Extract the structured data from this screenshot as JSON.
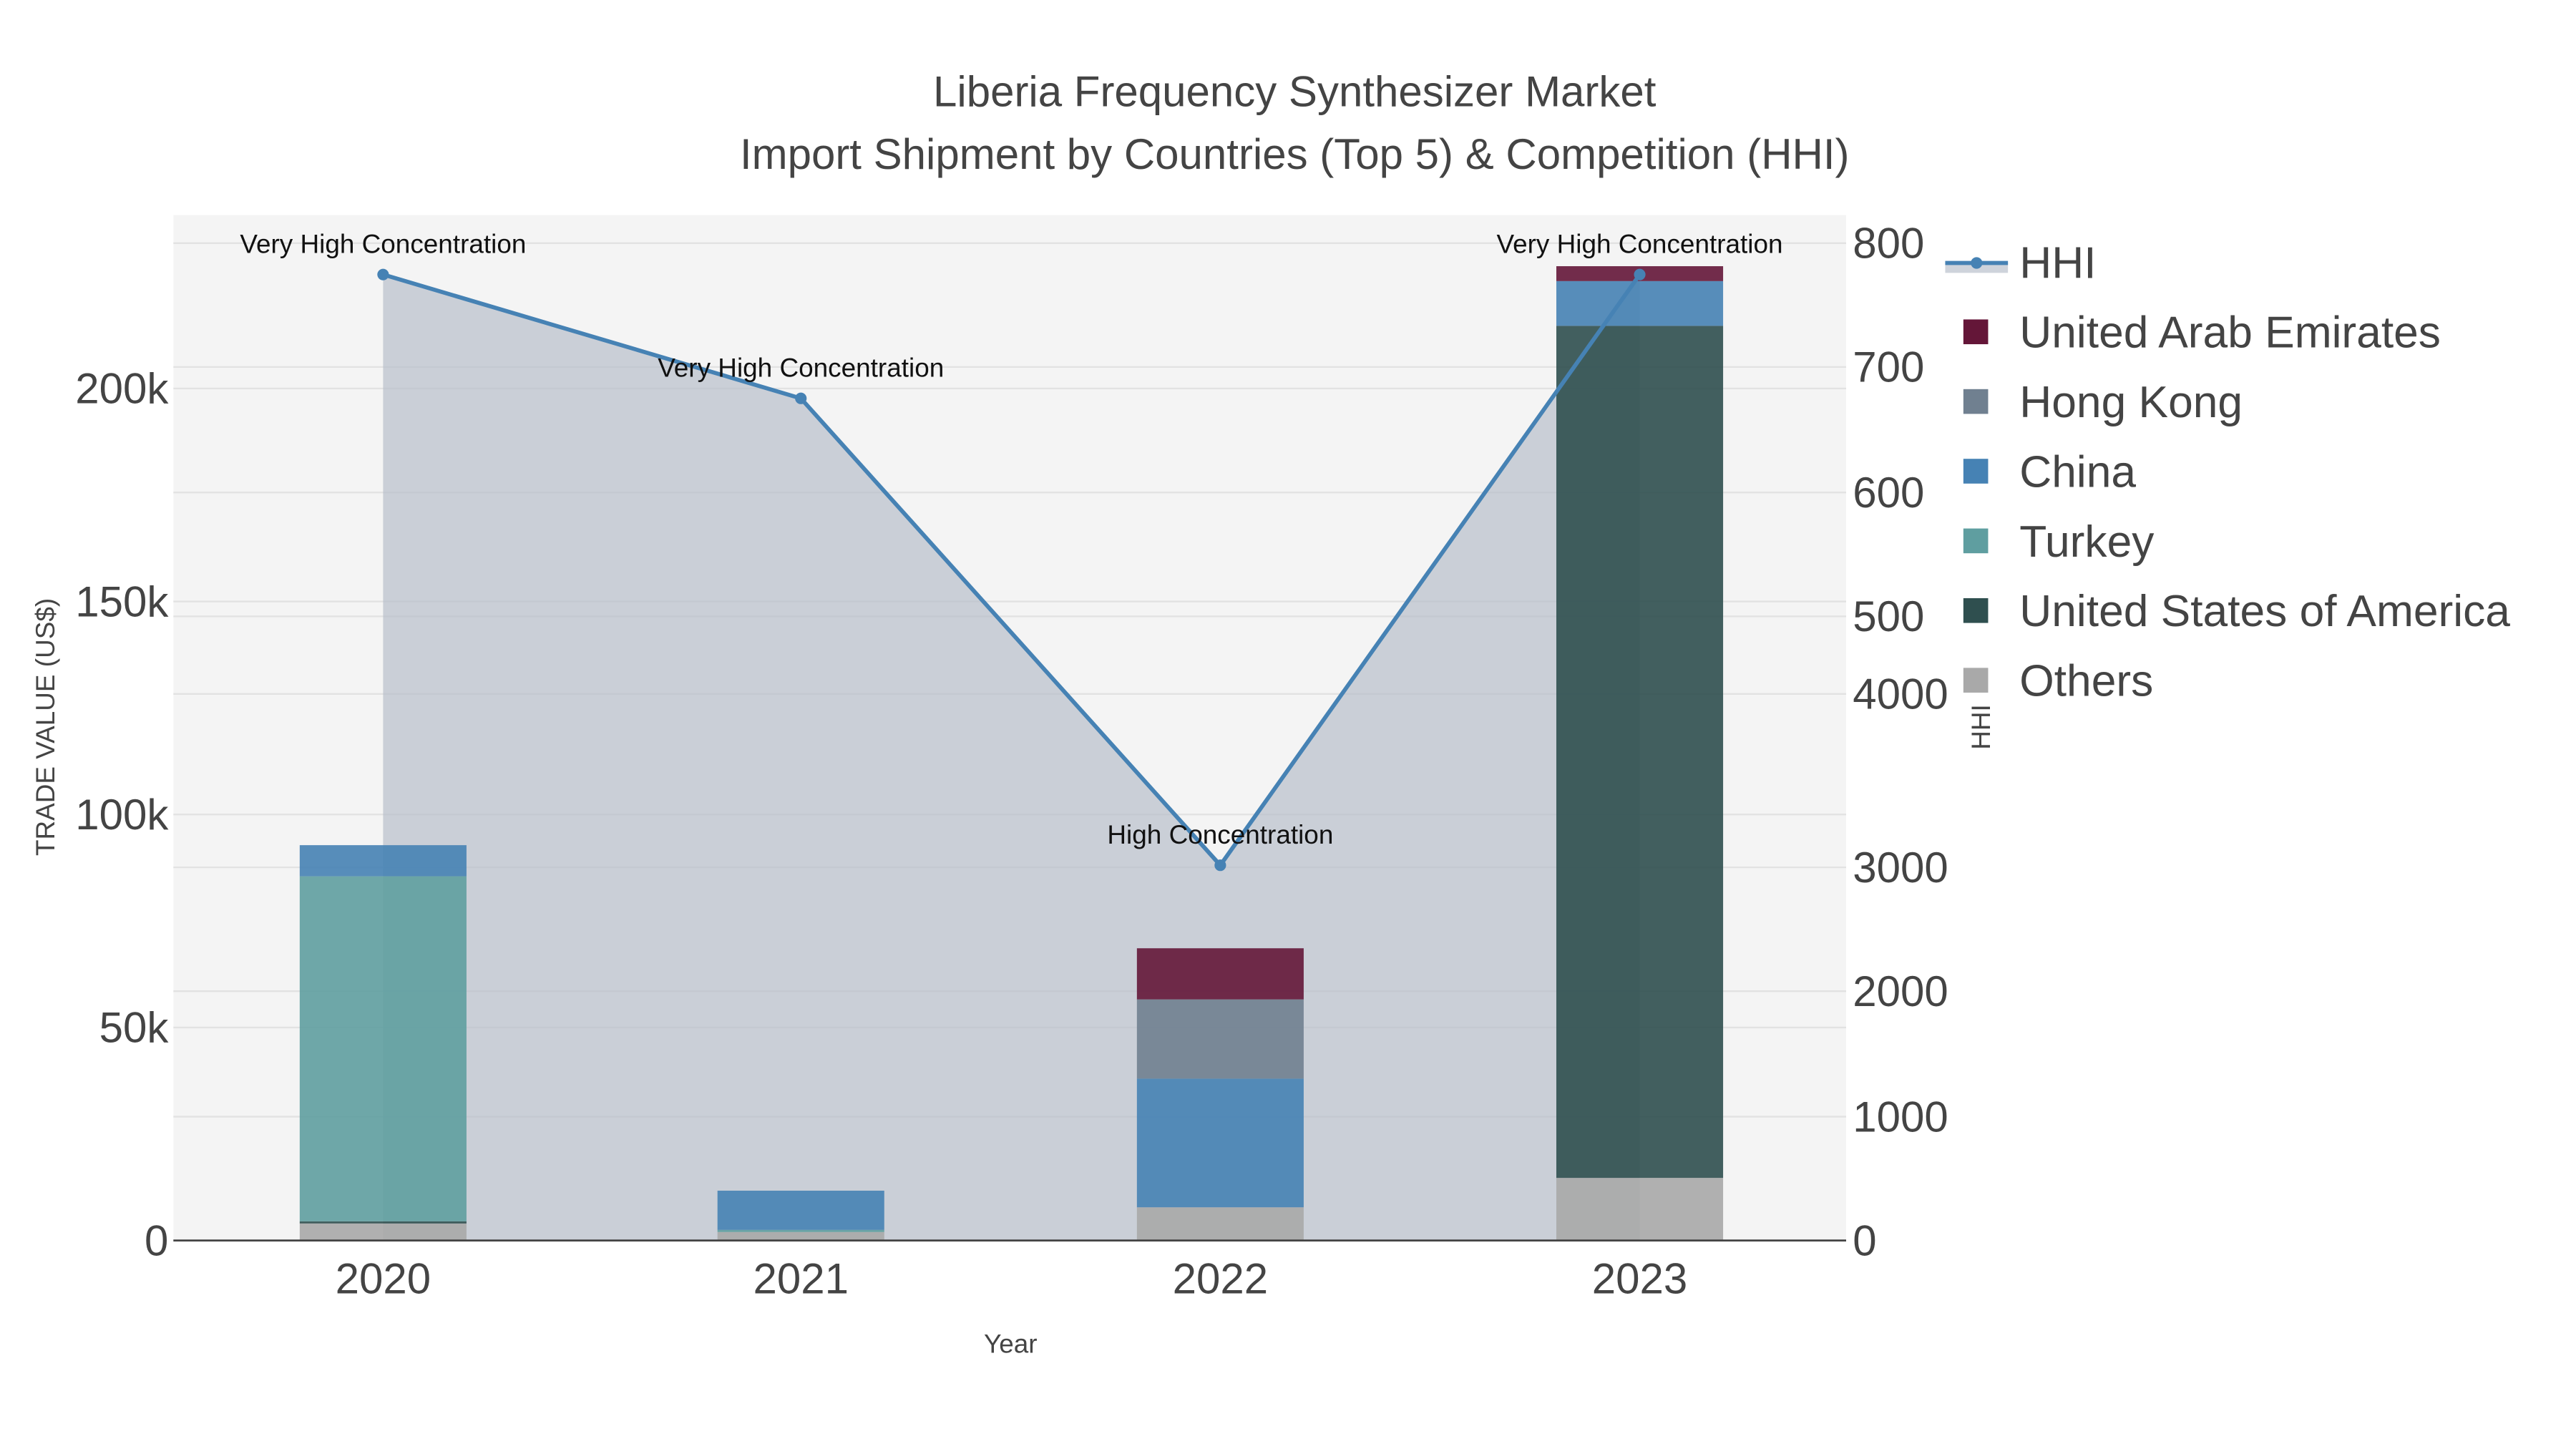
{
  "chart_data": {
    "type": "bar",
    "title": "Liberia Frequency Synthesizer Market",
    "subtitle": "Import Shipment by Countries (Top 5) & Competition (HHI)",
    "xlabel": "Year",
    "ylabel": "TRADE VALUE (US$)",
    "y2label": "HHI",
    "categories": [
      "2020",
      "2021",
      "2022",
      "2023"
    ],
    "ylim": [
      0,
      240000
    ],
    "y_ticks": [
      {
        "v": 0,
        "label": "0"
      },
      {
        "v": 50000,
        "label": "50k"
      },
      {
        "v": 100000,
        "label": "100k"
      },
      {
        "v": 150000,
        "label": "150k"
      },
      {
        "v": 200000,
        "label": "200k"
      }
    ],
    "y2_ticks": [
      {
        "v": 0,
        "label": "0"
      },
      {
        "v": 1000,
        "label": "1000"
      },
      {
        "v": 2000,
        "label": "2000"
      },
      {
        "v": 3000,
        "label": "3000"
      },
      {
        "v": 4000,
        "label": "4000"
      },
      {
        "v": 5000,
        "label": "500"
      },
      {
        "v": 6000,
        "label": "600"
      },
      {
        "v": 7000,
        "label": "700"
      },
      {
        "v": 8000,
        "label": "800"
      }
    ],
    "series": [
      {
        "name": "Others",
        "color": "#a9a9a9",
        "values": [
          4000,
          2000,
          7800,
          14700
        ]
      },
      {
        "name": "United States of America",
        "color": "#2f4f4f",
        "values": [
          500,
          0,
          0,
          200000
        ]
      },
      {
        "name": "Turkey",
        "color": "#5f9ea0",
        "values": [
          81000,
          500,
          0,
          0
        ]
      },
      {
        "name": "China",
        "color": "#4682b4",
        "values": [
          7300,
          9200,
          30200,
          10500
        ]
      },
      {
        "name": "Hong Kong",
        "color": "#708090",
        "values": [
          0,
          0,
          18600,
          0
        ]
      },
      {
        "name": "United Arab Emirates",
        "color": "#641638",
        "values": [
          0,
          0,
          12000,
          3500
        ]
      }
    ],
    "hhi": {
      "name": "HHI",
      "color": "#4682b4",
      "values": [
        7800,
        6800,
        3030,
        7800
      ],
      "annotations": [
        "Very High Concentration",
        "Very High Concentration",
        "High Concentration",
        "Very High Concentration"
      ]
    },
    "legend_order": [
      "HHI",
      "United Arab Emirates",
      "Hong Kong",
      "China",
      "Turkey",
      "United States of America",
      "Others"
    ],
    "legend_position": "right"
  }
}
